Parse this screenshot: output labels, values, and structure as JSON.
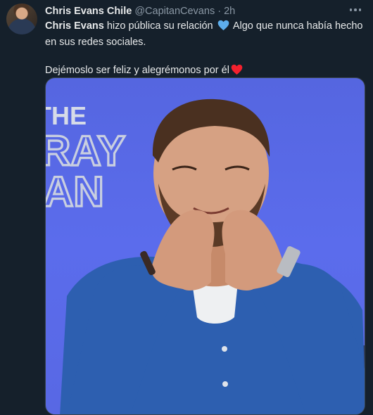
{
  "tweet": {
    "author_name": "Chris Evans Chile",
    "handle": "@CapitanCevans",
    "separator": "·",
    "time": "2h",
    "line1_bold": "Chris Evans",
    "line1_rest": " hizo pública su relación ",
    "line1_after_emoji": " Algo que nunca había hecho en sus redes sociales.",
    "line2": "Dejémoslo ser feliz y alegrémonos por él",
    "emoji_blue": "blue-heart-icon",
    "emoji_red": "red-heart-icon"
  },
  "media": {
    "backdrop_text_line1": "THE",
    "backdrop_text_line2": "RAY",
    "backdrop_text_line3": "AN"
  },
  "colors": {
    "background": "#15202b",
    "text": "#e7e9ea",
    "muted": "#8b98a5",
    "media_backdrop": "#5a6ae8",
    "cardigan": "#2d5fb0"
  }
}
